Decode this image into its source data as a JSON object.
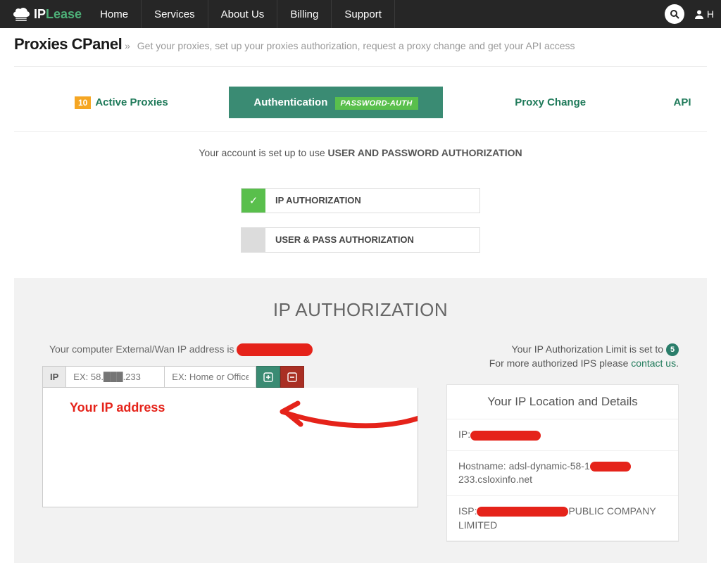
{
  "nav": {
    "logo_ip": "IP",
    "logo_lease": "Lease",
    "items": [
      "Home",
      "Services",
      "About Us",
      "Billing",
      "Support"
    ],
    "user_initial": "H"
  },
  "breadcrumb": {
    "title": "Proxies CPanel",
    "desc": "Get your proxies, set up your proxies authorization, request a proxy change and get your API access"
  },
  "tabs": {
    "active_count": "10",
    "active_label": "Active Proxies",
    "auth_label": "Authentication",
    "auth_badge": "PASSWORD-AUTH",
    "change_label": "Proxy Change",
    "api_label": "API"
  },
  "notice": {
    "pre": "Your account is set up to use ",
    "strong": "USER AND PASSWORD AUTHORIZATION"
  },
  "options": {
    "ip": "IP AUTHORIZATION",
    "userpass": "USER & PASS AUTHORIZATION"
  },
  "panel": {
    "title": "IP AUTHORIZATION",
    "wan_pre": "Your computer External/Wan IP address is ",
    "ip_tag": "IP",
    "ip_placeholder": "EX: 58.███.233",
    "label_placeholder": "EX: Home or Office",
    "annotation": "Your IP address",
    "limit_pre": "Your IP Authorization Limit is set to ",
    "limit_count": "5",
    "more_pre": "For more authorized IPS please ",
    "more_link": "contact us",
    "more_suffix": "."
  },
  "details": {
    "title": "Your IP Location and Details",
    "ip_label": "IP:",
    "hostname_label": "Hostname: ",
    "hostname_pre": "adsl-dynamic-58-1",
    "hostname_post": "233.csloxinfo.net",
    "isp_label": "ISP:",
    "isp_post": "PUBLIC COMPANY LIMITED"
  }
}
